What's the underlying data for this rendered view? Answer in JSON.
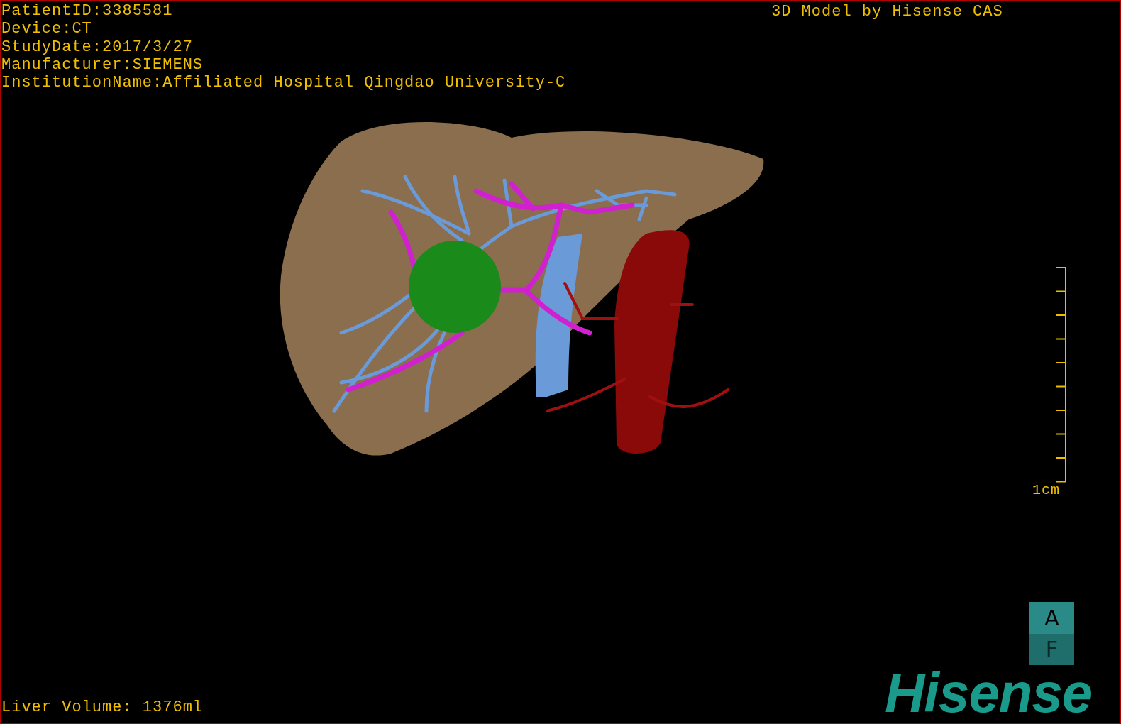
{
  "header_info": [
    "PatientID:3385581",
    "Device:CT",
    "StudyDate:2017/3/27",
    "Manufacturer:SIEMENS",
    "InstitutionName:Affiliated Hospital Qingdao University-C"
  ],
  "credit": "3D Model by Hisense CAS",
  "scale_bar": {
    "label": "1cm"
  },
  "orientation_cube": {
    "top": "A",
    "bottom": "F"
  },
  "logo": "Hisense",
  "footer": "Liver Volume: 1376ml"
}
